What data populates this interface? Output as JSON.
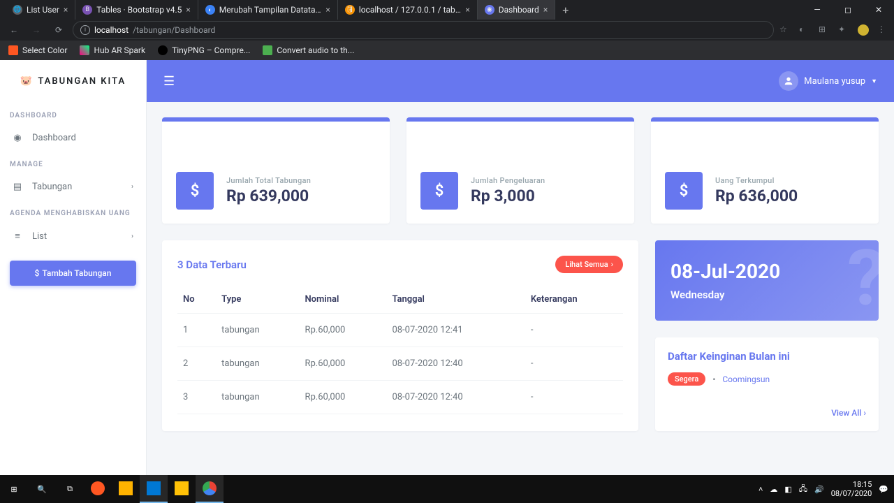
{
  "browser": {
    "tabs": [
      {
        "title": "List User"
      },
      {
        "title": "Tables · Bootstrap v4.5"
      },
      {
        "title": "Merubah Tampilan Datatable Me"
      },
      {
        "title": "localhost / 127.0.0.1 / tabungan |"
      },
      {
        "title": "Dashboard",
        "active": true
      }
    ],
    "url_domain": "localhost",
    "url_path": "/tabungan/Dashboard",
    "bookmarks": [
      {
        "label": "Select Color"
      },
      {
        "label": "Hub AR Spark"
      },
      {
        "label": "TinyPNG – Compre..."
      },
      {
        "label": "Convert audio to th..."
      }
    ]
  },
  "sidebar": {
    "brand": "TABUNGAN KITA",
    "sections": {
      "dashboard_title": "DASHBOARD",
      "dashboard_item": "Dashboard",
      "manage_title": "MANAGE",
      "manage_item": "Tabungan",
      "agenda_title": "AGENDA MENGHABISKAN UANG",
      "agenda_item": "List"
    },
    "add_button": "Tambah Tabungan"
  },
  "topbar": {
    "user_name": "Maulana yusup"
  },
  "stats": [
    {
      "label": "Jumlah Total Tabungan",
      "value": "Rp 639,000"
    },
    {
      "label": "Jumlah Pengeluaran",
      "value": "Rp 3,000"
    },
    {
      "label": "Uang Terkumpul",
      "value": "Rp 636,000"
    }
  ],
  "table": {
    "title": "3 Data Terbaru",
    "view_all": "Lihat Semua",
    "columns": [
      "No",
      "Type",
      "Nominal",
      "Tanggal",
      "Keterangan"
    ],
    "rows": [
      {
        "no": "1",
        "type": "tabungan",
        "nominal": "Rp.60,000",
        "tanggal": "08-07-2020 12:41",
        "ket": "-"
      },
      {
        "no": "2",
        "type": "tabungan",
        "nominal": "Rp.60,000",
        "tanggal": "08-07-2020 12:40",
        "ket": "-"
      },
      {
        "no": "3",
        "type": "tabungan",
        "nominal": "Rp.60,000",
        "tanggal": "08-07-2020 12:40",
        "ket": "-"
      }
    ]
  },
  "date_card": {
    "date": "08-Jul-2020",
    "day": "Wednesday"
  },
  "wish_card": {
    "title": "Daftar Keinginan Bulan ini",
    "badge": "Segera",
    "text": "Coomingsun",
    "view_all": "View All"
  },
  "taskbar": {
    "time": "18:15",
    "date": "08/07/2020"
  }
}
